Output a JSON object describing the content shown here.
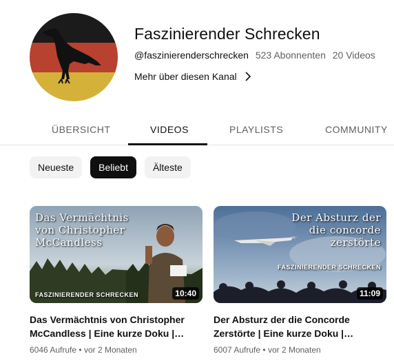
{
  "channel": {
    "name": "Faszinierender Schrecken",
    "handle": "@faszinierenderschrecken",
    "subscribers": "523 Abonnenten",
    "videos_count": "20 Videos",
    "about_link": "Mehr über diesen Kanal"
  },
  "tabs": [
    {
      "label": "ÜBERSICHT",
      "active": false
    },
    {
      "label": "VIDEOS",
      "active": true
    },
    {
      "label": "PLAYLISTS",
      "active": false
    },
    {
      "label": "COMMUNITY",
      "active": false
    }
  ],
  "chips": [
    {
      "label": "Neueste",
      "active": false
    },
    {
      "label": "Beliebt",
      "active": true
    },
    {
      "label": "Älteste",
      "active": false
    }
  ],
  "videos": [
    {
      "thumb_text_lines": [
        "Das Vermächtnis",
        "von Christopher",
        "McCandless"
      ],
      "thumb_brand": "faszinierender schrecken",
      "duration": "10:40",
      "title": "Das Vermächtnis von Christopher McCandless | Eine kurze Doku |…",
      "views": "6046 Aufrufe",
      "age": "vor 2 Monaten"
    },
    {
      "thumb_text_lines": [
        "Der Absturz der",
        "die concorde",
        "zerstörte"
      ],
      "thumb_brand": "faszinierender schrecken",
      "duration": "11:09",
      "title": "Der Absturz der die Concorde Zerstörte | Eine kurze Doku |…",
      "views": "6007 Aufrufe",
      "age": "vor 2 Monaten"
    }
  ],
  "meta_separator": "•",
  "colors": {
    "flag_black": "#1b1b1b",
    "flag_red": "#b8412f",
    "flag_gold": "#d4b23a",
    "active_chip": "#0f0f0f"
  }
}
